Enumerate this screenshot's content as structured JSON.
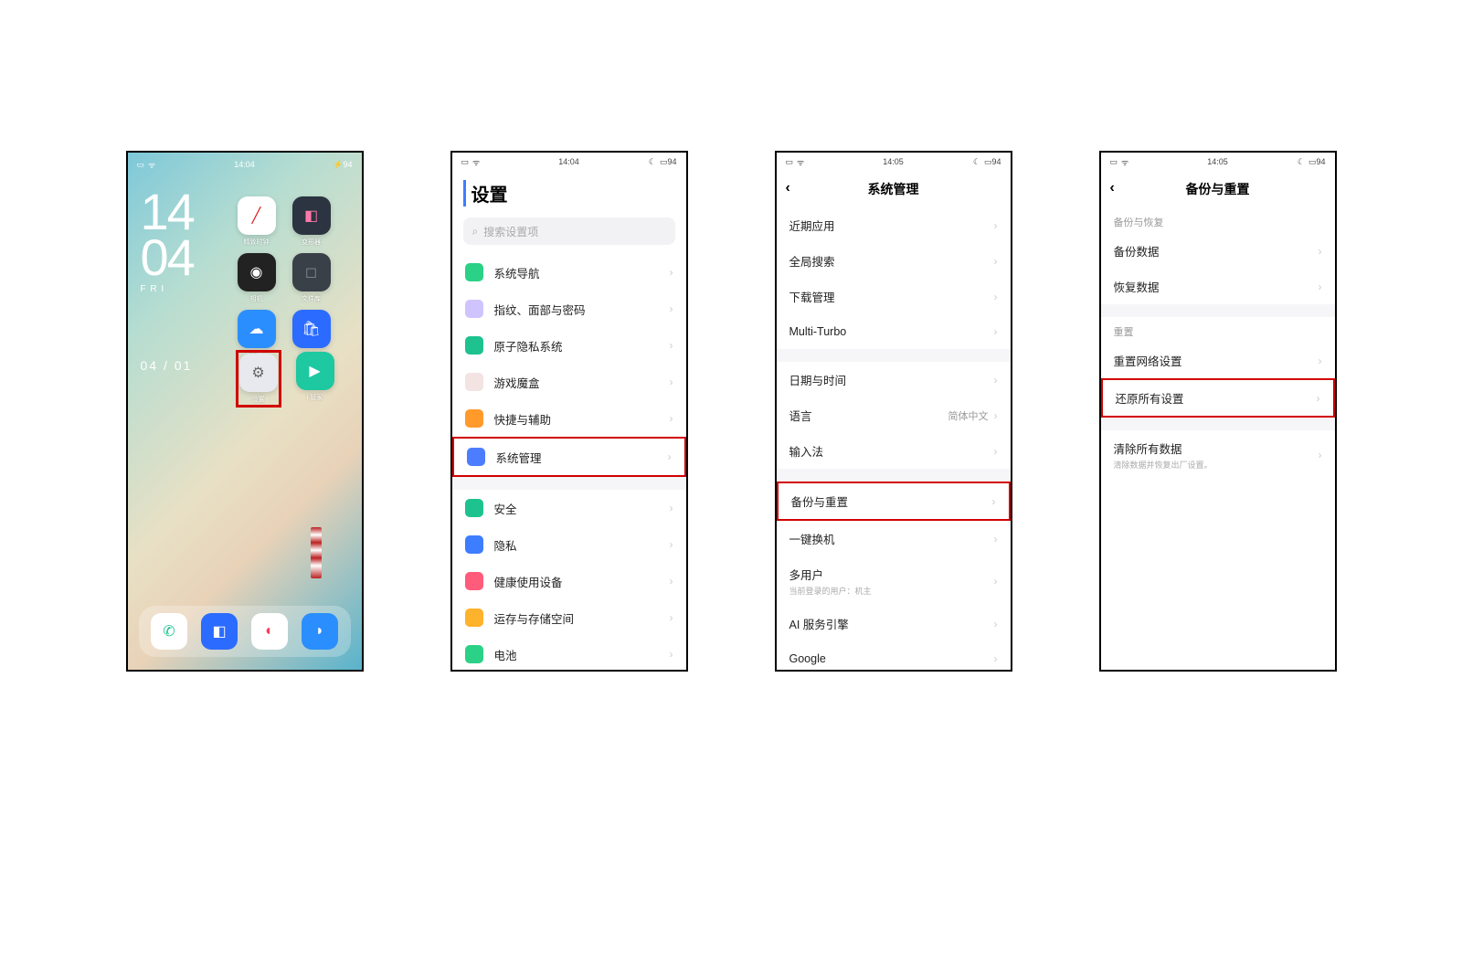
{
  "status": {
    "time1": "14:04",
    "time2": "14:04",
    "time3": "14:05",
    "time4": "14:05",
    "battery": "94"
  },
  "home": {
    "clock_h": "14",
    "clock_m": "04",
    "day_label": "F R I",
    "date": "04 / 01",
    "apps": {
      "r1a": "精致时钟",
      "r1b": "变形器",
      "r2a": "相机",
      "r2b": "文件库",
      "r3a": "天气",
      "r3b": "合同商店",
      "r4a": "设置",
      "r4b": "i 管家"
    }
  },
  "screen2": {
    "title": "设置",
    "search_placeholder": "搜索设置项",
    "items": [
      {
        "label": "系统导航"
      },
      {
        "label": "指纹、面部与密码"
      },
      {
        "label": "原子隐私系统"
      },
      {
        "label": "游戏魔盒"
      },
      {
        "label": "快捷与辅助"
      },
      {
        "label": "系统管理"
      }
    ],
    "items2": [
      {
        "label": "安全"
      },
      {
        "label": "隐私"
      },
      {
        "label": "健康使用设备"
      },
      {
        "label": "运存与存储空间"
      },
      {
        "label": "电池"
      }
    ]
  },
  "screen3": {
    "title": "系统管理",
    "g1": [
      {
        "label": "近期应用"
      },
      {
        "label": "全局搜索"
      },
      {
        "label": "下载管理"
      },
      {
        "label": "Multi-Turbo"
      }
    ],
    "g2": [
      {
        "label": "日期与时间"
      },
      {
        "label": "语言",
        "value": "简体中文"
      },
      {
        "label": "输入法"
      }
    ],
    "g3": [
      {
        "label": "备份与重置"
      },
      {
        "label": "一键换机"
      },
      {
        "label": "多用户",
        "sub": "当前登录的用户：机主"
      },
      {
        "label": "AI 服务引擎"
      },
      {
        "label": "Google"
      }
    ]
  },
  "screen4": {
    "title": "备份与重置",
    "section1_label": "备份与恢复",
    "s1": [
      {
        "label": "备份数据"
      },
      {
        "label": "恢复数据"
      }
    ],
    "section2_label": "重置",
    "s2": [
      {
        "label": "重置网络设置"
      },
      {
        "label": "还原所有设置"
      }
    ],
    "s3": [
      {
        "label": "清除所有数据",
        "sub": "清除数据并恢复出厂设置。"
      }
    ]
  },
  "iconcolors": {
    "nav": "#2bd186",
    "fp": "#8a6bff",
    "atom": "#1ec28f",
    "game": "#e7e7ed",
    "quick": "#ff9a2b",
    "sys": "#4d7dff",
    "sec": "#1ec28f",
    "priv": "#3d7dff",
    "health": "#ff5b7b",
    "store": "#ffb22b",
    "batt": "#2bd186"
  }
}
